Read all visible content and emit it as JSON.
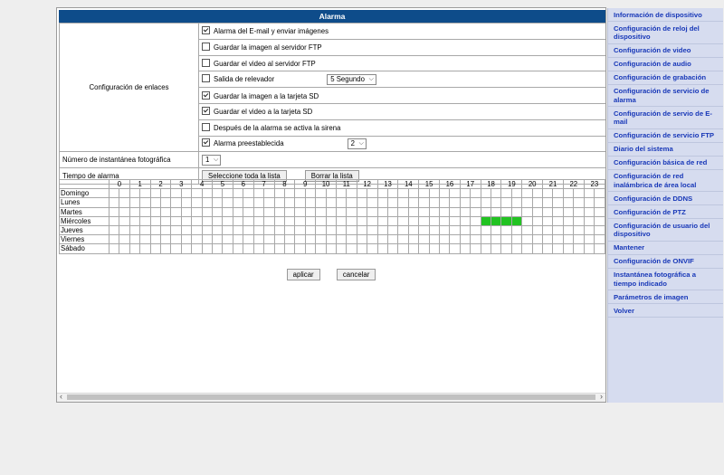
{
  "title": "Alarma",
  "config": {
    "link_config_label": "Configuración de enlaces",
    "options": [
      {
        "label": "Alarma del E-mail y enviar imágenes",
        "checked": true
      },
      {
        "label": "Guardar la imagen al servidor FTP",
        "checked": false
      },
      {
        "label": "Guardar el video al servidor FTP",
        "checked": false
      },
      {
        "label": "Salida de relevador",
        "checked": false,
        "select": "5 Segundo"
      },
      {
        "label": "Guardar la imagen a la tarjeta SD",
        "checked": true
      },
      {
        "label": "Guardar el video a la tarjeta SD",
        "checked": true
      },
      {
        "label": "Después de la alarma se activa la sirena",
        "checked": false
      },
      {
        "label": "Alarma preestablecida",
        "checked": true,
        "select": "2"
      }
    ],
    "snapshot_label": "Número de instantánea fotográfica",
    "snapshot_value": "1",
    "alarm_time_label": "Tiempo de alarma",
    "select_all_label": "Seleccione toda la lista",
    "clear_all_label": "Borrar la lista"
  },
  "schedule": {
    "hours": [
      "0",
      "1",
      "2",
      "3",
      "4",
      "5",
      "6",
      "7",
      "8",
      "9",
      "10",
      "11",
      "12",
      "13",
      "14",
      "15",
      "16",
      "17",
      "18",
      "19",
      "20",
      "21",
      "22",
      "23"
    ],
    "days": [
      "Domingo",
      "Lunes",
      "Martes",
      "Miércoles",
      "Jueves",
      "Viernes",
      "Sábado"
    ],
    "active": {
      "3": [
        36,
        37,
        38,
        39
      ]
    }
  },
  "actions": {
    "apply": "aplicar",
    "cancel": "cancelar"
  },
  "sidebar": [
    "Información de dispositivo",
    "Configuración de reloj del dispositivo",
    "Configuración de video",
    "Configuración de audio",
    "Configuración de grabación",
    "Configuración de servicio de alarma",
    "Configuración de servio de E-mail",
    "Configuración de servicio FTP",
    "Diario del sistema",
    "Configuración básica de red",
    "Configuración de red inalámbrica de área local",
    "Configuración de DDNS",
    "Configuración de PTZ",
    "Configuración de usuario del dispositivo",
    "Mantener",
    "Configuración de ONVIF",
    "Instantánea fotográfica a tiempo indicado",
    "Parámetros de imagen",
    "Volver"
  ],
  "colors": {
    "header": "#0e4c8a",
    "active_slot": "#22c322",
    "sidebar_bg": "#d6dcef",
    "link": "#1838b8"
  }
}
